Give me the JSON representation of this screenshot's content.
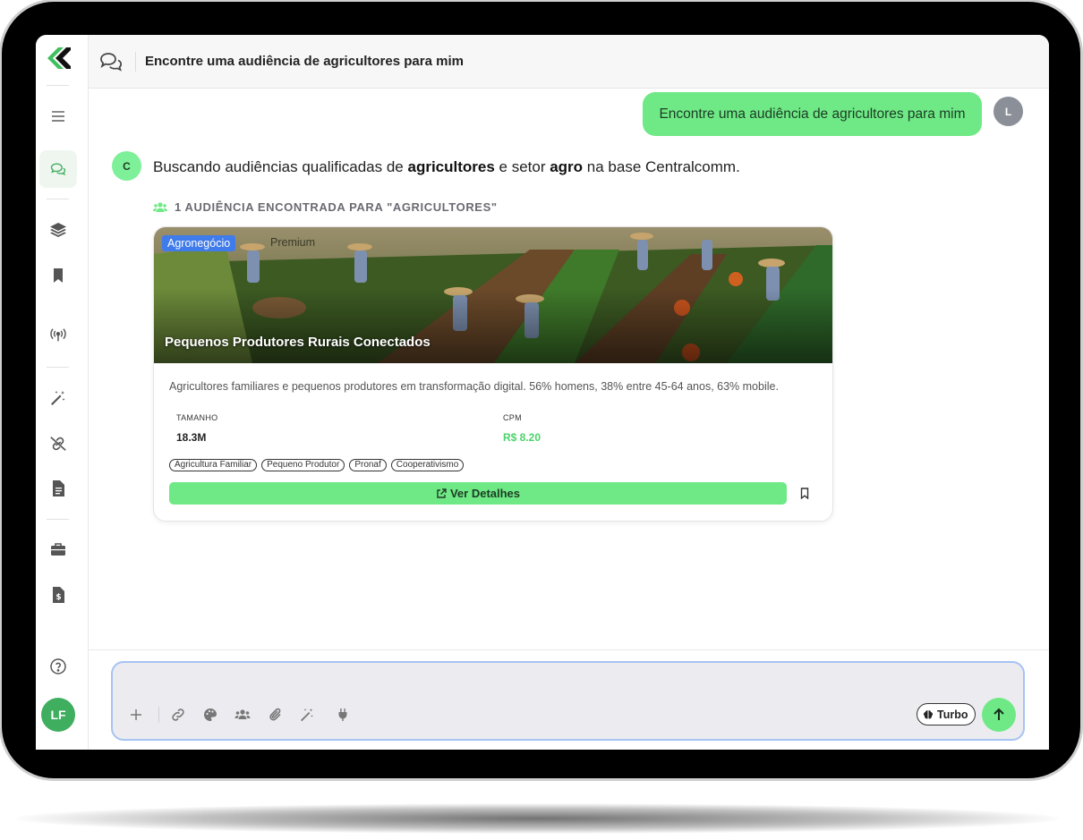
{
  "header": {
    "title": "Encontre uma audiência de agricultores para mim"
  },
  "sidebar": {
    "items": [
      "menu",
      "chat",
      "layers",
      "bookmark",
      "broadcast",
      "magic-wand",
      "link-off",
      "document",
      "briefcase",
      "invoice",
      "help"
    ],
    "user_initials": "LF"
  },
  "conversation": {
    "user_message": "Encontre uma audiência de agricultores para mim",
    "user_avatar": "L",
    "bot_avatar": "C",
    "bot_text": {
      "part1": "Buscando audiências qualificadas de ",
      "bold1": "agricultores",
      "part2": " e setor ",
      "bold2": "agro",
      "part3": " na base Centralcomm."
    },
    "found_label": "1 AUDIÊNCIA ENCONTRADA PARA \"AGRICULTORES\""
  },
  "card": {
    "sector_tag": "Agronegócio",
    "premium_tag": "Premium",
    "title": "Pequenos Produtores Rurais Conectados",
    "description": "Agricultores familiares e pequenos produtores em transformação digital. 56% homens, 38% entre 45-64 anos, 63% mobile.",
    "metrics": [
      {
        "label": "TAMANHO",
        "value": "18.3M"
      },
      {
        "label": "CPM",
        "value": "R$ 8.20"
      }
    ],
    "chips": [
      "Agricultura Familiar",
      "Pequeno Produtor",
      "Pronaf",
      "Cooperativismo"
    ],
    "details_button": "Ver Detalhes"
  },
  "composer": {
    "tools": [
      "plus-icon",
      "link-icon",
      "palette-icon",
      "users-icon",
      "paperclip-icon",
      "magic-wand-icon",
      "plug-icon"
    ],
    "turbo_label": "Turbo"
  },
  "colors": {
    "accent_green": "#6ee985",
    "tag_blue": "#3f7bea",
    "composer_border": "#a6c3f2"
  }
}
